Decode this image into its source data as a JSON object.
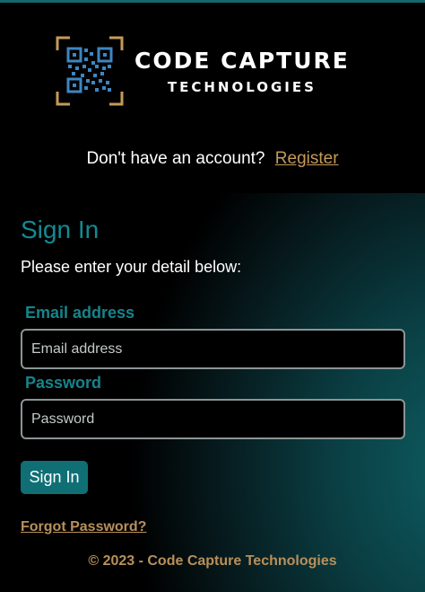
{
  "brand": {
    "name": "CODE CAPTURE",
    "subtitle": "TECHNOLOGIES",
    "logo_icon": "qr-code-icon",
    "colors": {
      "accent_gold": "#c59a5a",
      "accent_teal": "#138a93"
    }
  },
  "register": {
    "prompt": "Don't have an account?",
    "link_label": "Register"
  },
  "form": {
    "title": "Sign In",
    "instructions": "Please enter your detail below:",
    "email": {
      "label": "Email address",
      "placeholder": "Email address",
      "value": ""
    },
    "password": {
      "label": "Password",
      "placeholder": "Password",
      "value": ""
    },
    "submit_label": "Sign In",
    "forgot_label": "Forgot Password?"
  },
  "footer": {
    "copyright": "© 2023 - Code Capture Technologies"
  }
}
